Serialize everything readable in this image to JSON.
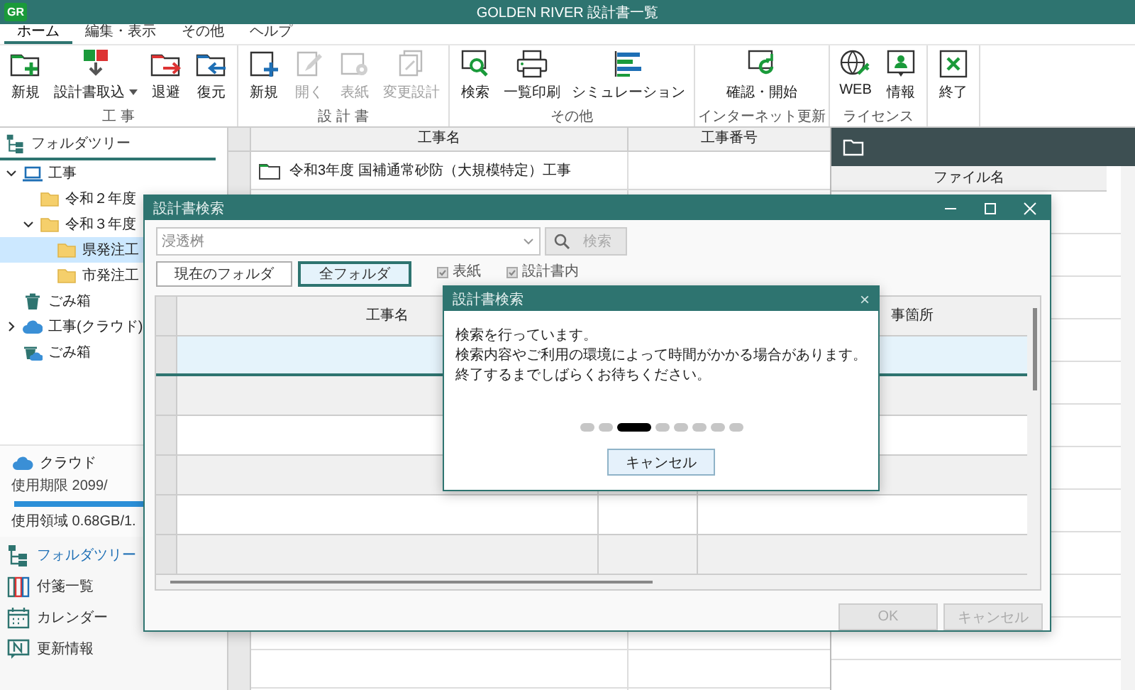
{
  "window": {
    "title": "GOLDEN RIVER 設計書一覧",
    "logo": "GR"
  },
  "menu_tabs": [
    {
      "label": "ホーム",
      "selected": true
    },
    {
      "label": "編集・表示",
      "selected": false
    },
    {
      "label": "その他",
      "selected": false
    },
    {
      "label": "ヘルプ",
      "selected": false
    }
  ],
  "ribbon": {
    "groups": [
      {
        "label": "工 事",
        "buttons": [
          {
            "label": "新規",
            "disabled": false
          },
          {
            "label": "設計書取込",
            "disabled": false,
            "dropdown": true
          },
          {
            "label": "退避",
            "disabled": false
          },
          {
            "label": "復元",
            "disabled": false
          }
        ]
      },
      {
        "label": "設 計 書",
        "buttons": [
          {
            "label": "新規",
            "disabled": false
          },
          {
            "label": "開く",
            "disabled": true
          },
          {
            "label": "表紙",
            "disabled": true
          },
          {
            "label": "変更設計",
            "disabled": true
          }
        ]
      },
      {
        "label": "その他",
        "buttons": [
          {
            "label": "検索",
            "disabled": false
          },
          {
            "label": "一覧印刷",
            "disabled": false
          },
          {
            "label": "シミュレーション",
            "disabled": false
          }
        ]
      },
      {
        "label": "インターネット更新",
        "buttons": [
          {
            "label": "確認・開始",
            "disabled": false
          }
        ]
      },
      {
        "label": "ライセンス",
        "buttons": [
          {
            "label": "WEB",
            "disabled": false
          },
          {
            "label": "情報",
            "disabled": false
          }
        ]
      },
      {
        "buttons": [
          {
            "label": "終了",
            "disabled": false
          }
        ]
      }
    ]
  },
  "folder_tree": {
    "title": "フォルダツリー",
    "items": [
      {
        "kind": "computer",
        "label": "工事",
        "expanded": true,
        "selected": false,
        "children": [
          {
            "kind": "folder",
            "label": "令和２年度",
            "selected": false
          },
          {
            "kind": "folder",
            "label": "令和３年度",
            "expanded": true,
            "selected": false,
            "children": [
              {
                "kind": "folder",
                "label": "県発注工",
                "selected": true
              },
              {
                "kind": "folder",
                "label": "市発注工",
                "selected": false
              }
            ]
          }
        ]
      },
      {
        "kind": "trash",
        "label": "ごみ箱",
        "selected": false
      },
      {
        "kind": "cloud",
        "label": "工事(クラウド)",
        "expanded": false,
        "selected": false
      },
      {
        "kind": "cloudtrash",
        "label": "ごみ箱",
        "selected": false
      }
    ]
  },
  "cloud": {
    "label": "クラウド",
    "expiry": "使用期限 2099/",
    "level": 0.68,
    "usage": "使用領域 0.68GB/1."
  },
  "nav": [
    {
      "label": "フォルダツリー",
      "selected": true
    },
    {
      "label": "付箋一覧",
      "selected": false
    },
    {
      "label": "カレンダー",
      "selected": false
    },
    {
      "label": "更新情報",
      "selected": false
    }
  ],
  "project_table": {
    "columns": [
      "工事名",
      "工事番号"
    ],
    "rows": [
      {
        "name": "令和3年度 国補通常砂防（大規模特定）工事"
      }
    ]
  },
  "file_panel": {
    "columns": [
      "ファイル名"
    ]
  },
  "search_dialog": {
    "title": "設計書検索",
    "query": "浸透桝",
    "search_button": {
      "label": "検索",
      "disabled": true
    },
    "scope_buttons": [
      {
        "label": "現在のフォルダ",
        "selected": false
      },
      {
        "label": "全フォルダ",
        "selected": true
      }
    ],
    "options": [
      {
        "label": "表紙",
        "checked": true,
        "disabled": true
      },
      {
        "label": "設計書内",
        "checked": true,
        "disabled": true
      }
    ],
    "column_1": "工事名",
    "column_3": "事箇所",
    "rows": [
      {
        "selected": true
      },
      {
        "selected": false
      },
      {
        "selected": false
      },
      {
        "selected": false
      },
      {
        "selected": false
      },
      {
        "selected": false
      }
    ],
    "ok_button": {
      "label": "OK",
      "disabled": true
    },
    "cancel_button": {
      "label": "キャンセル",
      "disabled": true
    }
  },
  "progress_dialog": {
    "title": "設計書検索",
    "close": "×",
    "message": [
      "検索を行っています。",
      "検索内容やご利用の環境によって時間がかかる場合があります。",
      "終了するまでしばらくお待ちください。"
    ],
    "dots": [
      {
        "selected": false
      },
      {
        "selected": false
      },
      {
        "selected": true
      },
      {
        "selected": false
      },
      {
        "selected": false
      },
      {
        "selected": false
      },
      {
        "selected": false
      },
      {
        "selected": false
      }
    ],
    "cancel_button": {
      "label": "キャンセル"
    }
  }
}
